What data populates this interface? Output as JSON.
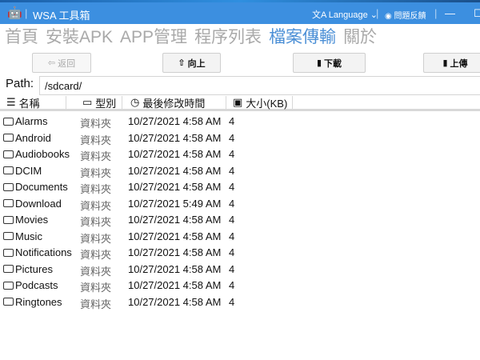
{
  "titlebar": {
    "app_title": "WSA 工具箱",
    "language_label": "Language",
    "feedback_label": "問題反饋",
    "minimize": "—",
    "maximize": "☐"
  },
  "nav": {
    "tabs": [
      {
        "label": "首頁"
      },
      {
        "label": "安裝APK"
      },
      {
        "label": "APP管理"
      },
      {
        "label": "程序列表"
      },
      {
        "label": "檔案傳輸",
        "active": true
      },
      {
        "label": "關於"
      }
    ]
  },
  "toolbar": {
    "back": "返回",
    "up": "向上",
    "download": "下載",
    "upload": "上傳"
  },
  "path": {
    "label": "Path:",
    "value": "/sdcard/"
  },
  "columns": {
    "name": "名稱",
    "type": "型別",
    "modified": "最後修改時間",
    "size": "大小(KB)"
  },
  "files": [
    {
      "name": "Alarms",
      "type": "資料夾",
      "modified": "10/27/2021 4:58 AM",
      "size": "4"
    },
    {
      "name": "Android",
      "type": "資料夾",
      "modified": "10/27/2021 4:58 AM",
      "size": "4"
    },
    {
      "name": "Audiobooks",
      "type": "資料夾",
      "modified": "10/27/2021 4:58 AM",
      "size": "4"
    },
    {
      "name": "DCIM",
      "type": "資料夾",
      "modified": "10/27/2021 4:58 AM",
      "size": "4"
    },
    {
      "name": "Documents",
      "type": "資料夾",
      "modified": "10/27/2021 4:58 AM",
      "size": "4"
    },
    {
      "name": "Download",
      "type": "資料夾",
      "modified": "10/27/2021 5:49 AM",
      "size": "4"
    },
    {
      "name": "Movies",
      "type": "資料夾",
      "modified": "10/27/2021 4:58 AM",
      "size": "4"
    },
    {
      "name": "Music",
      "type": "資料夾",
      "modified": "10/27/2021 4:58 AM",
      "size": "4"
    },
    {
      "name": "Notifications",
      "type": "資料夾",
      "modified": "10/27/2021 4:58 AM",
      "size": "4"
    },
    {
      "name": "Pictures",
      "type": "資料夾",
      "modified": "10/27/2021 4:58 AM",
      "size": "4"
    },
    {
      "name": "Podcasts",
      "type": "資料夾",
      "modified": "10/27/2021 4:58 AM",
      "size": "4"
    },
    {
      "name": "Ringtones",
      "type": "資料夾",
      "modified": "10/27/2021 4:58 AM",
      "size": "4"
    }
  ]
}
